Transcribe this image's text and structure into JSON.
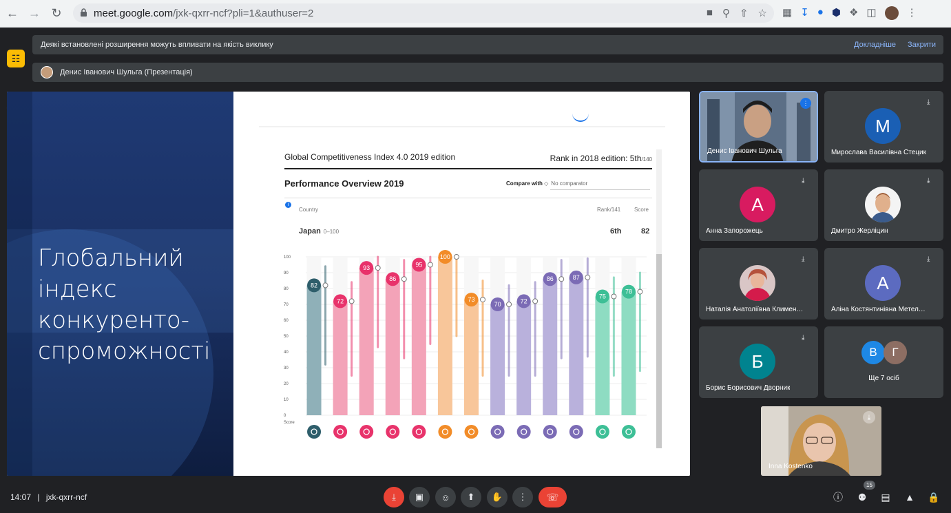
{
  "browser": {
    "url_main": "meet.google.com",
    "url_path": "/jxk-qxrr-ncf?pli=1&authuser=2",
    "icons": [
      "back-icon",
      "forward-icon",
      "reload-icon",
      "lock-icon",
      "camera-icon",
      "zoom-icon",
      "share-icon",
      "bookmark-star-icon",
      "extension-icon",
      "download-icon",
      "profile-icon",
      "menu-icon"
    ]
  },
  "banners": {
    "warning_text": "Деякі встановлені розширення можуть впливати на якість виклику",
    "learn_more": "Докладніше",
    "close": "Закрити",
    "presenter_text": "Денис Іванович Шульга (Презентація)"
  },
  "slide": {
    "title": "Глобальний індекс конкуренто-спроможності",
    "gci_title": "Global Competitiveness Index 4.0  2019 edition",
    "gci_rank": "Rank in 2018 edition: 5th",
    "gci_rank_of": "/140",
    "perf_title": "Performance Overview 2019",
    "compare_label": "Compare with",
    "compare_value": "No comparator",
    "hdr_country": "Country",
    "hdr_rank": "Rank/141",
    "hdr_score": "Score",
    "country": "Japan",
    "country_range": "0–100",
    "rank": "6th",
    "score": "82",
    "y_label": "Score"
  },
  "chart_data": {
    "type": "bar",
    "ylim": [
      0,
      100
    ],
    "yticks": [
      0,
      10,
      20,
      30,
      40,
      50,
      60,
      70,
      80,
      90,
      100
    ],
    "ylabel": "Score",
    "values": [
      82,
      72,
      93,
      86,
      95,
      100,
      73,
      70,
      72,
      86,
      87,
      75,
      78
    ],
    "colors": [
      "#2e5e6b",
      "#e8336b",
      "#e8336b",
      "#e8336b",
      "#e8336b",
      "#f28c28",
      "#f28c28",
      "#7b6bb5",
      "#7b6bb5",
      "#7b6bb5",
      "#7b6bb5",
      "#3dbf96",
      "#3dbf96"
    ],
    "light_colors": [
      "#8fb0b8",
      "#f3a3b8",
      "#f3a3b8",
      "#f3a3b8",
      "#f3a3b8",
      "#f8c69a",
      "#f8c69a",
      "#b9b1dc",
      "#b9b1dc",
      "#b9b1dc",
      "#b9b1dc",
      "#8edcc2",
      "#8edcc2"
    ]
  },
  "participants": [
    {
      "name": "Денис Іванович Шульга",
      "initial": "",
      "color": "",
      "type": "video",
      "active": true
    },
    {
      "name": "Мирослава Василівна Стецик",
      "initial": "M",
      "color": "#1a5fb4",
      "type": "avatar",
      "active": false
    },
    {
      "name": "Анна Запорожець",
      "initial": "A",
      "color": "#d81b60",
      "type": "avatar",
      "active": false
    },
    {
      "name": "Дмитро Жерліцин",
      "initial": "",
      "color": "",
      "type": "photo",
      "active": false
    },
    {
      "name": "Наталія Анатоліївна Климен…",
      "initial": "",
      "color": "",
      "type": "photo",
      "active": false
    },
    {
      "name": "Аліна Костянтинівна Метел…",
      "initial": "A",
      "color": "#5c6bc0",
      "type": "avatar",
      "active": false
    },
    {
      "name": "Борис Борисович Дворник",
      "initial": "Б",
      "color": "#00838f",
      "type": "avatar",
      "active": false
    }
  ],
  "others": {
    "label": "Ще 7 осіб",
    "av1": "В",
    "av1_color": "#1e88e5",
    "av2": "Г",
    "av2_color": "#8d6e63"
  },
  "self_view": {
    "name": "Inna Kostenko"
  },
  "bottom": {
    "time": "14:07",
    "divider": "|",
    "meeting_code": "jxk-qxrr-ncf",
    "participant_count": "15"
  }
}
